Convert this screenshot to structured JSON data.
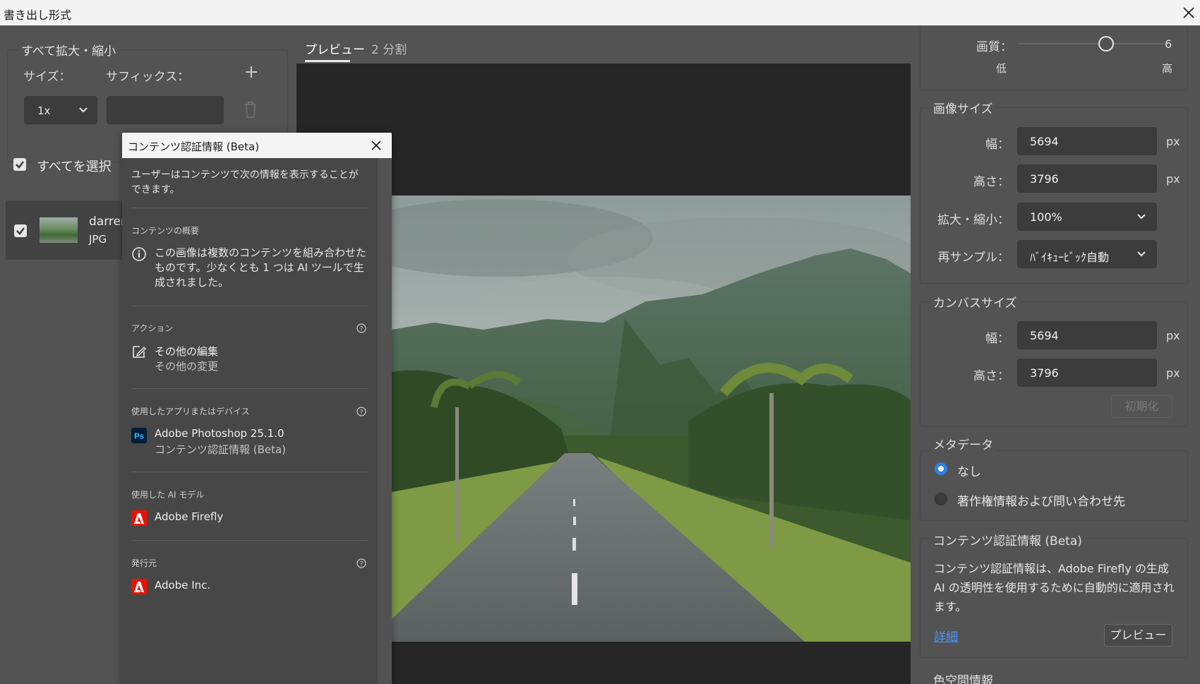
{
  "window": {
    "title": "書き出し形式"
  },
  "left_panel": {
    "scale_legend": "すべて拡大・縮小",
    "size_label": "サイズ：",
    "suffix_label": "サフィックス：",
    "size_value": "1x",
    "suffix_value": "",
    "select_all_label": "すべてを選択",
    "file_name": "darren",
    "file_type": "JPG"
  },
  "preview": {
    "tabs": [
      "プレビュー",
      "2 分割"
    ],
    "active_tab": "プレビュー"
  },
  "popup": {
    "title": "コンテンツ認証情報 (Beta)",
    "description": "ユーザーはコンテンツで次の情報を表示することができます。",
    "overview": {
      "heading": "コンテンツの概要",
      "text": "この画像は複数のコンテンツを組み合わせたものです。少なくとも 1 つは AI ツールで生成されました。"
    },
    "actions": {
      "heading": "アクション",
      "main": "その他の編集",
      "sub": "その他の変更"
    },
    "app": {
      "heading": "使用したアプリまたはデバイス",
      "main": "Adobe Photoshop 25.1.0",
      "sub": "コンテンツ認証情報 (Beta)"
    },
    "model": {
      "heading": "使用した AI モデル",
      "main": "Adobe Firefly"
    },
    "issuer": {
      "heading": "発行元",
      "main": "Adobe Inc."
    }
  },
  "right_panel": {
    "quality": {
      "label": "画質：",
      "value": "6",
      "low": "低",
      "high": "高",
      "level_fraction": 0.6
    },
    "image_size": {
      "legend": "画像サイズ",
      "width_label": "幅：",
      "width_value": "5694",
      "height_label": "高さ：",
      "height_value": "3796",
      "scale_label": "拡大・縮小：",
      "scale_value": "100%",
      "resample_label": "再サンプル：",
      "resample_value": "ﾊﾞｲｷｭｰﾋﾞｯｸ自動",
      "unit": "px"
    },
    "canvas_size": {
      "legend": "カンバスサイズ",
      "width_label": "幅：",
      "width_value": "5694",
      "height_label": "高さ：",
      "height_value": "3796",
      "unit": "px",
      "reset_label": "初期化"
    },
    "metadata": {
      "legend": "メタデータ",
      "option_none": "なし",
      "option_copyright": "著作権情報および問い合わせ先",
      "selected": "なし"
    },
    "content_credentials": {
      "legend": "コンテンツ認証情報 (Beta)",
      "text": "コンテンツ認証情報は、Adobe Firefly の生成 AI の透明性を使用するために自動的に適用されます。",
      "link": "詳細",
      "preview_button": "プレビュー"
    },
    "color_space": {
      "legend": "色空間情報"
    }
  },
  "colors": {
    "accent": "#2f7fe0",
    "link": "#4d93f0",
    "panel": "#535353",
    "canvas": "#262626",
    "adobe_red": "#eb1000"
  }
}
